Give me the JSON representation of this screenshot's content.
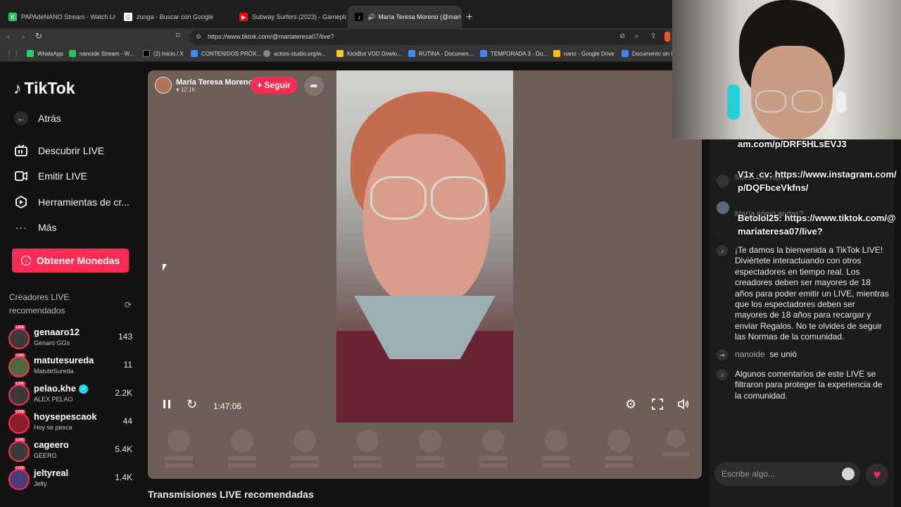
{
  "browser": {
    "tabs": [
      {
        "title": "PAPAdeNANO Stream - Watch Live o",
        "color": "#22c55e",
        "glyph": "K"
      },
      {
        "title": "zunga - Buscar con Google",
        "color": "#ffffff",
        "glyph": "G"
      },
      {
        "title": "Subway Surfers (2023) - Gameplay (F",
        "color": "#ff0000",
        "glyph": "▶"
      },
      {
        "title": "María Teresa Moreno (@mari",
        "color": "#000000",
        "glyph": "♪"
      }
    ],
    "url": "https://www.tiktok.com/@mariateresa07/live?",
    "bookmarks": [
      {
        "label": "WhatsApp",
        "color": "#25d366"
      },
      {
        "label": "nanoide Stream - W...",
        "color": "#22c55e"
      },
      {
        "label": "(2) Inicio / X",
        "color": "#000000"
      },
      {
        "label": "CONTENIDOS PRÓX...",
        "color": "#4285f4"
      },
      {
        "label": "actors-studio.org/w...",
        "color": "#888888"
      },
      {
        "label": "KickBot VOD Dowlo...",
        "color": "#facc15"
      },
      {
        "label": "RUTINA - Documen...",
        "color": "#4285f4"
      },
      {
        "label": "TEMPORADA 3 - Do...",
        "color": "#4285f4"
      },
      {
        "label": "nano - Google Drive",
        "color": "#fbbc04"
      },
      {
        "label": "Documento sin t",
        "color": "#4285f4"
      }
    ]
  },
  "sidebar": {
    "logo": "TikTok",
    "back": "Atrás",
    "nav": [
      {
        "label": "Descubrir LIVE",
        "icon": "tv-icon"
      },
      {
        "label": "Emitir LIVE",
        "icon": "camera-icon"
      },
      {
        "label": "Herramientas de cr...",
        "icon": "play-icon"
      },
      {
        "label": "Más",
        "icon": "more-icon"
      }
    ],
    "coins_label": "Obtener Monedas",
    "recommended_title": "Creadores LIVE recomendados",
    "live_badge": "LIVE",
    "creators": [
      {
        "name": "genaaro12",
        "sub": "Genaro GGs",
        "count": "143",
        "verified": false
      },
      {
        "name": "matutesureda",
        "sub": "MatuteSureda",
        "count": "11",
        "verified": false
      },
      {
        "name": "pelao.khe",
        "sub": "ALEX PELAO",
        "count": "2.2K",
        "verified": true
      },
      {
        "name": "hoysepescaok",
        "sub": "Hoy se pesca",
        "count": "44",
        "verified": false
      },
      {
        "name": "cageero",
        "sub": "GEERO",
        "count": "5.4K",
        "verified": false
      },
      {
        "name": "jeltyreal",
        "sub": "Jelty",
        "count": "1.4K",
        "verified": false
      }
    ]
  },
  "player": {
    "host_name": "María Teresa Moreno",
    "host_likes": "♥ 12.1K",
    "follow_label": "+ Seguir",
    "elapsed": "1:47:06"
  },
  "recommended_live_heading": "Transmisiones LIVE recomendadas",
  "chat": {
    "overlay_lines": [
      "am.com/p/DRF5HLsEVJ3",
      "V1x_cv: https://www.instagram.com/",
      "p/DQFbceVkfns/",
      "Betolol25: https://www.tiktok.com/@",
      "mariateresa07/live?"
    ],
    "ghost_lines": [
      "Mario Carvajal",
      "María cómo andas?"
    ],
    "welcome": "¡Te damos la bienvenida a TikTok LIVE! Diviértete interactuando con otros espectadores en tiempo real. Los creadores deben ser mayores de 18 años para poder emitir un LIVE, mientras que los espectadores deben ser mayores de 18 años para recargar y enviar Regalos. No te olvides de seguir las Normas de la comunidad.",
    "join_user": "nanoide",
    "join_text": "se unió",
    "filter_notice": "Algunos comentarios de este LIVE se filtraron para proteger la experiencia de la comunidad.",
    "input_placeholder": "Escribe algo..."
  }
}
